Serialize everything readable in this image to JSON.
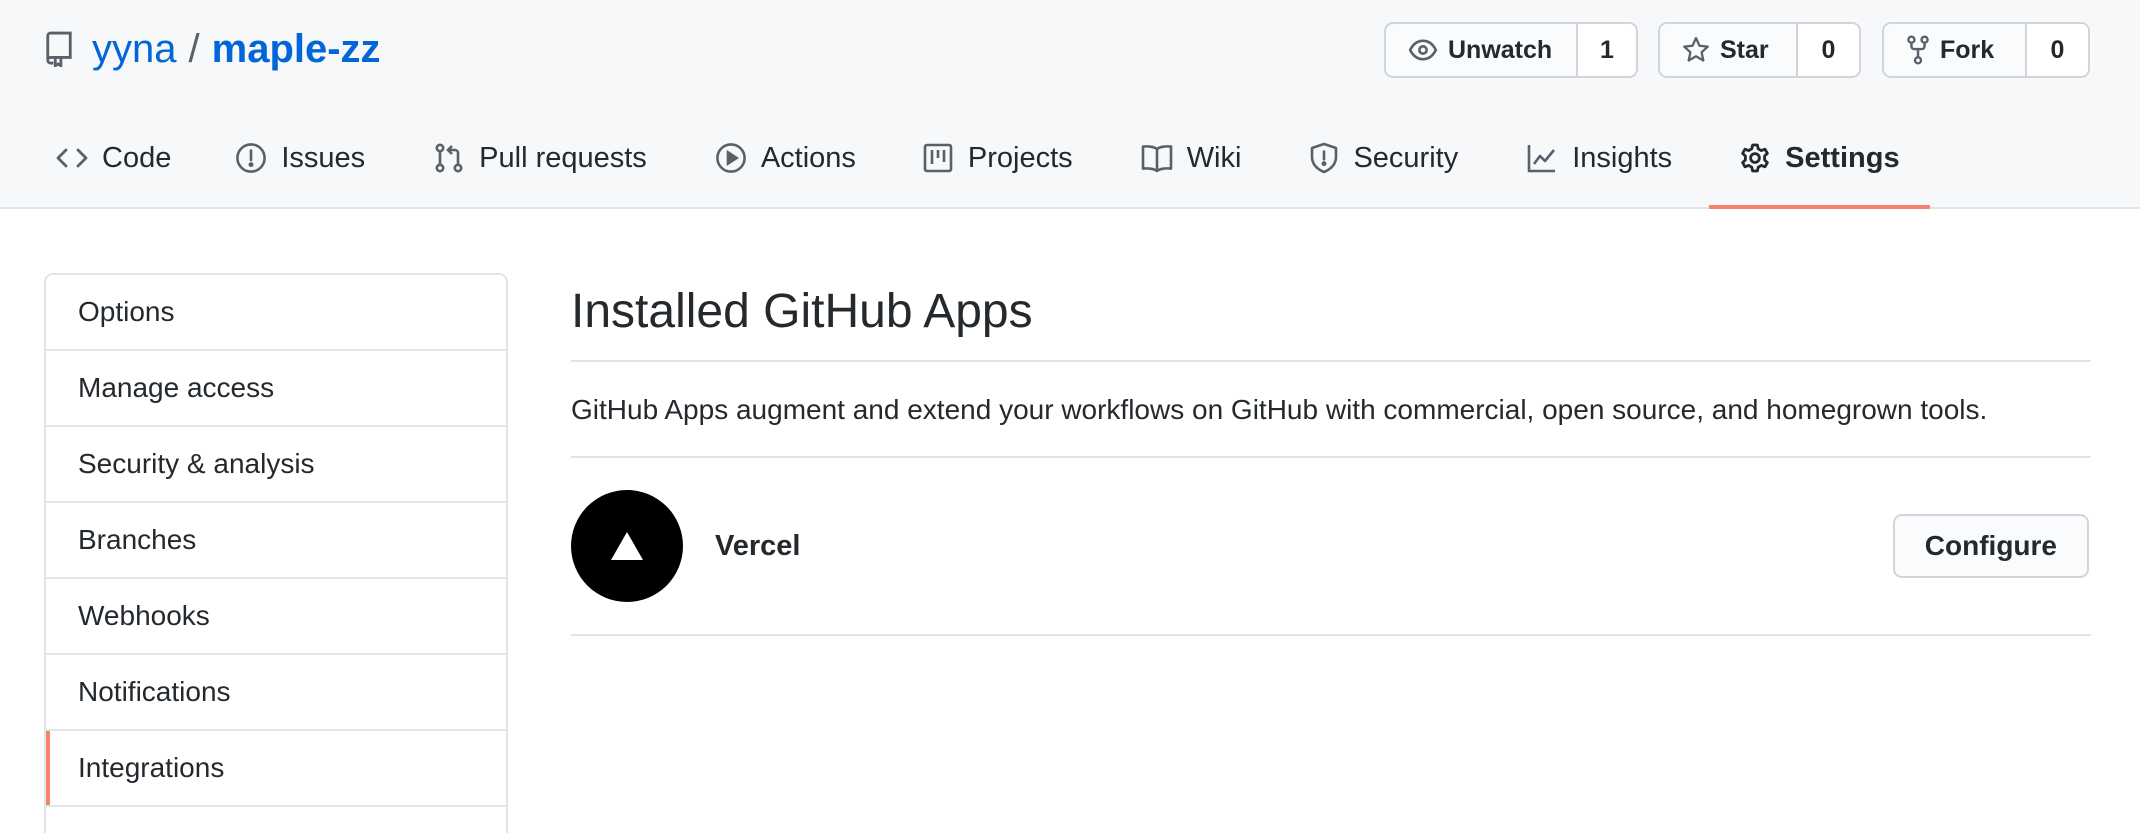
{
  "repo": {
    "owner": "yyna",
    "separator": "/",
    "name": "maple-zz"
  },
  "actions": {
    "watch": {
      "label": "Unwatch",
      "count": "1"
    },
    "star": {
      "label": "Star",
      "count": "0"
    },
    "fork": {
      "label": "Fork",
      "count": "0"
    }
  },
  "tabs": [
    {
      "label": "Code",
      "icon": "code-icon"
    },
    {
      "label": "Issues",
      "icon": "issue-icon"
    },
    {
      "label": "Pull requests",
      "icon": "pull-request-icon"
    },
    {
      "label": "Actions",
      "icon": "play-icon"
    },
    {
      "label": "Projects",
      "icon": "project-icon"
    },
    {
      "label": "Wiki",
      "icon": "book-icon"
    },
    {
      "label": "Security",
      "icon": "shield-icon"
    },
    {
      "label": "Insights",
      "icon": "graph-icon"
    },
    {
      "label": "Settings",
      "icon": "gear-icon",
      "selected": true
    }
  ],
  "sidebar": {
    "items": [
      {
        "label": "Options"
      },
      {
        "label": "Manage access"
      },
      {
        "label": "Security & analysis"
      },
      {
        "label": "Branches"
      },
      {
        "label": "Webhooks"
      },
      {
        "label": "Notifications"
      },
      {
        "label": "Integrations",
        "selected": true
      }
    ]
  },
  "main": {
    "title": "Installed GitHub Apps",
    "description": "GitHub Apps augment and extend your workflows on GitHub with commercial, open source, and homegrown tools.",
    "apps": [
      {
        "name": "Vercel",
        "action": "Configure"
      }
    ]
  },
  "colors": {
    "link": "#0366d6",
    "selected_underline": "#f9826c",
    "header_bg": "#f6f8fa"
  }
}
